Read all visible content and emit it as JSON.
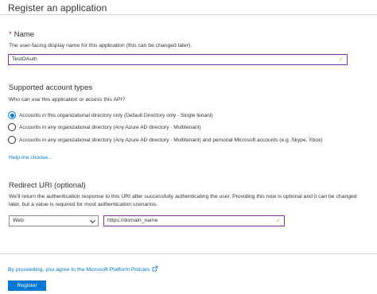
{
  "page": {
    "title": "Register an application"
  },
  "name_section": {
    "required_mark": "*",
    "heading": "Name",
    "help_text": "The user-facing display name for this application (this can be changed later).",
    "input_value": "TestOAuth",
    "valid_icon": "check-icon"
  },
  "account_types": {
    "heading": "Supported account types",
    "question": "Who can use this application or access this API?",
    "options": [
      {
        "label": "Accounts in this organizational directory only (Default Directory only - Single tenant)",
        "selected": true
      },
      {
        "label": "Accounts in any organizational directory (Any Azure AD directory - Multitenant)",
        "selected": false
      },
      {
        "label": "Accounts in any organizational directory (Any Azure AD directory - Multitenant) and personal Microsoft accounts (e.g. Skype, Xbox)",
        "selected": false
      }
    ],
    "help_link": "Help me choose..."
  },
  "redirect": {
    "heading": "Redirect URI (optional)",
    "help_text": "We'll return the authentication response to this URI after successfully authenticating the user. Providing this now is optional and it can be changed later, but a value is required for most authentication scenarios.",
    "platform_value": "Web",
    "uri_value": "https://domain_name"
  },
  "footer": {
    "policy_link": "By proceeding, you agree to the Microsoft Platform Policies",
    "register_label": "Register"
  },
  "colors": {
    "accent": "#0078d4",
    "focus_border": "#8a2da5",
    "valid_check": "#a3b800",
    "required": "#a4262c"
  }
}
